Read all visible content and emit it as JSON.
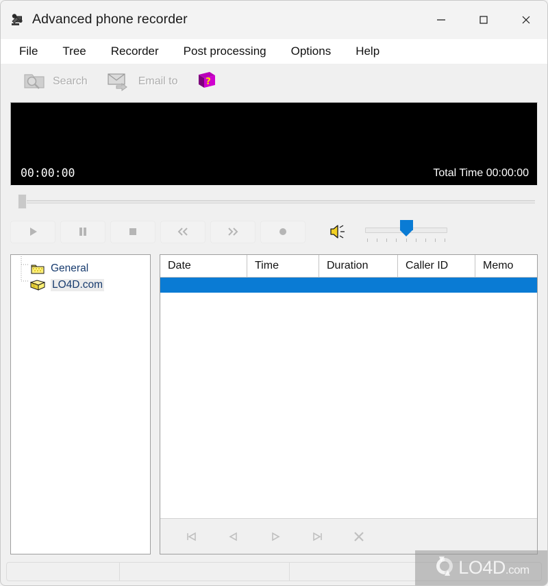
{
  "window": {
    "title": "Advanced phone recorder",
    "app_icon": "phone-recorder-icon",
    "controls": {
      "minimize": "minimize-icon",
      "maximize": "maximize-icon",
      "close": "close-icon"
    }
  },
  "menu": {
    "items": [
      {
        "label": "File"
      },
      {
        "label": "Tree"
      },
      {
        "label": "Recorder"
      },
      {
        "label": "Post processing"
      },
      {
        "label": "Options"
      },
      {
        "label": "Help"
      }
    ]
  },
  "toolbar": {
    "search_label": "Search",
    "search_icon": "folder-search-icon",
    "email_label": "Email to",
    "email_icon": "envelope-arrow-icon",
    "help_icon": "help-book-icon"
  },
  "display": {
    "current_time": "00:00:00",
    "total_time_label": "Total Time 00:00:00",
    "background_color": "#000000"
  },
  "seek": {
    "position_percent": 0
  },
  "transport": {
    "buttons": [
      {
        "name": "play-button",
        "icon": "play-icon",
        "enabled": false
      },
      {
        "name": "pause-button",
        "icon": "pause-icon",
        "enabled": false
      },
      {
        "name": "stop-button",
        "icon": "stop-icon",
        "enabled": false
      },
      {
        "name": "rewind-button",
        "icon": "rewind-icon",
        "enabled": false
      },
      {
        "name": "fast-forward-button",
        "icon": "fast-forward-icon",
        "enabled": false
      },
      {
        "name": "record-button",
        "icon": "record-icon",
        "enabled": false
      }
    ]
  },
  "volume": {
    "speaker_icon": "speaker-icon",
    "level_percent": 50,
    "tick_count": 9,
    "accent_color": "#0a7bd4"
  },
  "tree": {
    "nodes": [
      {
        "label": "General",
        "icon": "closed-folder-icon",
        "selected": false
      },
      {
        "label": "LO4D.com",
        "icon": "open-folder-icon",
        "selected": true
      }
    ]
  },
  "list": {
    "columns": [
      {
        "label": "Date"
      },
      {
        "label": "Time"
      },
      {
        "label": "Duration"
      },
      {
        "label": "Caller ID"
      },
      {
        "label": "Memo"
      }
    ],
    "rows": [],
    "selected_row_color": "#0a7bd4",
    "nav_buttons": [
      {
        "name": "first-record-button",
        "icon": "skip-to-start-icon"
      },
      {
        "name": "previous-record-button",
        "icon": "previous-icon"
      },
      {
        "name": "next-record-button",
        "icon": "next-icon"
      },
      {
        "name": "last-record-button",
        "icon": "skip-to-end-icon"
      },
      {
        "name": "delete-record-button",
        "icon": "delete-x-icon"
      }
    ]
  },
  "statusbar": {
    "panes": [
      "",
      "",
      ""
    ]
  },
  "watermark": {
    "text": "LO4D",
    "suffix": ".com",
    "icon": "lo4d-circular-arrows-icon"
  }
}
